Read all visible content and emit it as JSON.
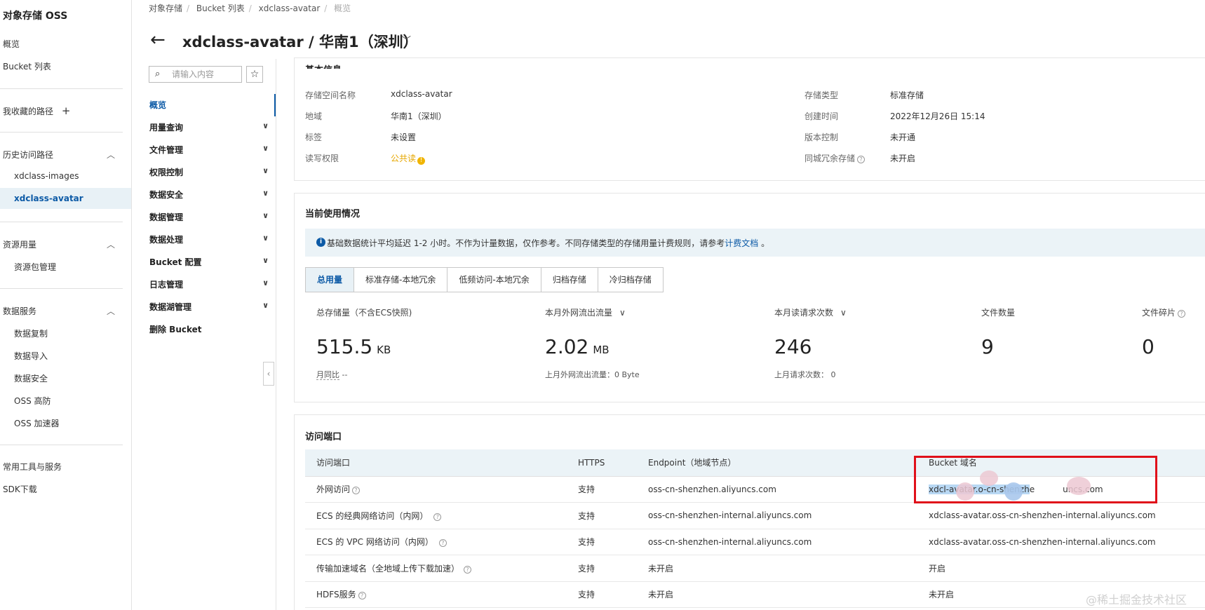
{
  "left_nav": {
    "title": "对象存储 OSS",
    "overview": "概览",
    "bucket_list": "Bucket 列表",
    "favorites": "我收藏的路径",
    "add_icon": "plus-icon",
    "history": "历史访问路径",
    "history_items": [
      "xdclass-images",
      "xdclass-avatar"
    ],
    "resource_usage": "资源用量",
    "resource_pkg": "资源包管理",
    "data_services": "数据服务",
    "data_service_items": [
      "数据复制",
      "数据导入",
      "数据安全",
      "OSS 高防",
      "OSS 加速器"
    ],
    "tools": "常用工具与服务",
    "sdk": "SDK下载"
  },
  "breadcrumb": [
    "对象存储",
    "Bucket 列表",
    "xdclass-avatar",
    "概览"
  ],
  "page_title": "xdclass-avatar / 华南1（深圳）",
  "sec_menu": {
    "search_placeholder": "请输入内容",
    "items": [
      "概览",
      "用量查询",
      "文件管理",
      "权限控制",
      "数据安全",
      "数据管理",
      "数据处理",
      "Bucket 配置",
      "日志管理",
      "数据湖管理",
      "删除 Bucket"
    ]
  },
  "basic_info": {
    "title": "基本信息",
    "left": [
      {
        "key": "存储空间名称",
        "value": "xdclass-avatar"
      },
      {
        "key": "地域",
        "value": "华南1（深圳）"
      },
      {
        "key": "标签",
        "value": "未设置"
      },
      {
        "key": "读写权限",
        "value": "公共读"
      }
    ],
    "right": [
      {
        "key": "存储类型",
        "value": "标准存储"
      },
      {
        "key": "创建时间",
        "value": "2022年12月26日 15:14"
      },
      {
        "key": "版本控制",
        "value": "未开通"
      },
      {
        "key": "同城冗余存储",
        "value": "未开启"
      }
    ]
  },
  "usage": {
    "title": "当前使用情况",
    "notice": "基础数据统计平均延迟 1-2 小时。不作为计量数据，仅作参考。不同存储类型的存储用量计费规则，请参考",
    "notice_link": "计费文档",
    "notice_end": "。",
    "tabs": [
      "总用量",
      "标准存储-本地冗余",
      "低频访问-本地冗余",
      "归档存储",
      "冷归档存储"
    ],
    "metrics": [
      {
        "label": "总存储量（不含ECS快照)",
        "value": "515.5",
        "unit": "KB",
        "sub_label": "月同比",
        "sub_value": "--"
      },
      {
        "label": "本月外网流出流量",
        "value": "2.02",
        "unit": "MB",
        "sub_label": "上月外网流出流量：",
        "sub_value": "0 Byte"
      },
      {
        "label": "本月读请求次数",
        "value": "246",
        "unit": "",
        "sub_label": "上月请求次数：",
        "sub_value": "0"
      },
      {
        "label": "文件数量",
        "value": "9",
        "unit": "",
        "sub_label": "",
        "sub_value": ""
      },
      {
        "label": "文件碎片",
        "value": "0",
        "unit": "",
        "sub_label": "",
        "sub_value": ""
      }
    ]
  },
  "endpoints": {
    "title": "访问端口",
    "headers": [
      "访问端口",
      "HTTPS",
      "Endpoint（地域节点）",
      "Bucket 域名"
    ],
    "rows": [
      {
        "name": "外网访问",
        "https": "支持",
        "endpoint": "oss-cn-shenzhen.aliyuncs.com",
        "domain_a": "xdcl",
        "domain_b": "-avatar.o",
        "domain_c": "-cn-shenzh",
        "domain_d": "e",
        "domain_e": "uncs.com"
      },
      {
        "name": "ECS 的经典网络访问（内网）",
        "https": "支持",
        "endpoint": "oss-cn-shenzhen-internal.aliyuncs.com",
        "domain": "xdclass-avatar.oss-cn-shenzhen-internal.aliyuncs.com"
      },
      {
        "name": "ECS 的 VPC 网络访问（内网）",
        "https": "支持",
        "endpoint": "oss-cn-shenzhen-internal.aliyuncs.com",
        "domain": "xdclass-avatar.oss-cn-shenzhen-internal.aliyuncs.com"
      },
      {
        "name": "传输加速域名（全地域上传下载加速）",
        "https": "支持",
        "endpoint": "未开启",
        "domain": "开启"
      },
      {
        "name": "HDFS服务",
        "https": "支持",
        "endpoint": "未开启",
        "domain": "未开启"
      }
    ]
  },
  "watermark": "@稀土掘金技术社区",
  "colors": {
    "accent": "#0c5aa6",
    "success": "#2e9a4a",
    "warning": "#e6a700",
    "highlight_box": "#e0101a"
  }
}
